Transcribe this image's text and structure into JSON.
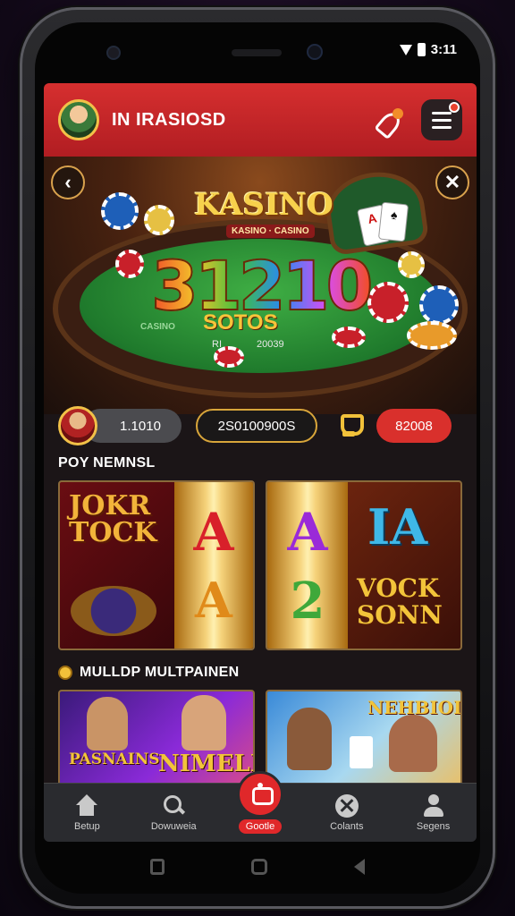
{
  "status_bar": {
    "time": "3:11",
    "battery_icon": "battery-icon",
    "signal_icon": "signal-icon"
  },
  "header": {
    "title": "IN IRASIOSD",
    "avatar_icon": "avatar-icon",
    "rocket_icon": "rocket-icon",
    "menu_icon": "hamburger-menu-icon"
  },
  "hero": {
    "brand": "KASINO",
    "brand_sub": "KASINO · CASINO",
    "big_number": "31210",
    "slogan": "SOTOS",
    "felt_label": "CASINO",
    "mini_a": "RI",
    "mini_b": "20039",
    "back_icon": "chevron-left-icon",
    "close_icon": "close-icon"
  },
  "stats": {
    "balance": "1.1010",
    "jackpot": "2S0100900S",
    "badge": "82008",
    "trophy_icon": "trophy-icon"
  },
  "sections": [
    {
      "title": "POY NEMNSL",
      "tiles": [
        {
          "headline": "JOKR TOCK",
          "reel_letters": [
            "A",
            "A"
          ]
        },
        {
          "reel_letters": [
            "A",
            "2"
          ],
          "headline": "IA",
          "subline": "VOCK SONN"
        }
      ]
    },
    {
      "title": "MULLDP MULTPAINEN",
      "tiles": [
        {
          "headline": "PASNAINS",
          "subline": "NIMELI"
        },
        {
          "headline": "NEHBIOD"
        }
      ]
    }
  ],
  "bottom_nav": [
    {
      "label": "Betup",
      "icon": "home-icon"
    },
    {
      "label": "Dowuweia",
      "icon": "search-icon"
    },
    {
      "label": "Gootle",
      "icon": "game-icon",
      "active": true
    },
    {
      "label": "Colants",
      "icon": "tools-icon"
    },
    {
      "label": "Segens",
      "icon": "user-icon"
    }
  ],
  "colors": {
    "brand_red": "#d62f2f",
    "gold": "#f2c13a",
    "felt_green": "#1f7a2c",
    "nav_bg": "#2a2b2f"
  }
}
